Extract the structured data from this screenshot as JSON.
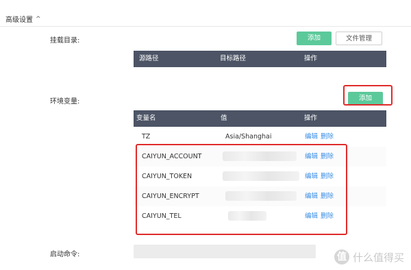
{
  "section": {
    "title": "高级设置",
    "chevron": "^"
  },
  "mount": {
    "label": "挂载目录:",
    "add_button": "添加",
    "file_button": "文件管理",
    "columns": [
      "源路径",
      "目标路径",
      "操作"
    ]
  },
  "env": {
    "label": "环境变量:",
    "add_button": "添加",
    "columns": [
      "变量名",
      "值",
      "操作"
    ],
    "rows": [
      {
        "name": "TZ",
        "value": "Asia/Shanghai",
        "edit": "编辑",
        "delete": "删除"
      },
      {
        "name": "CAIYUN_ACCOUNT",
        "value": "",
        "edit": "编辑",
        "delete": "删除"
      },
      {
        "name": "CAIYUN_TOKEN",
        "value": "",
        "edit": "编辑",
        "delete": "删除"
      },
      {
        "name": "CAIYUN_ENCRYPT",
        "value": "",
        "edit": "编辑",
        "delete": "删除"
      },
      {
        "name": "CAIYUN_TEL",
        "value": "",
        "edit": "编辑",
        "delete": "删除"
      }
    ]
  },
  "startup": {
    "label": "启动命令:"
  },
  "watermark": {
    "logo": "值",
    "text": "什么值得买"
  }
}
